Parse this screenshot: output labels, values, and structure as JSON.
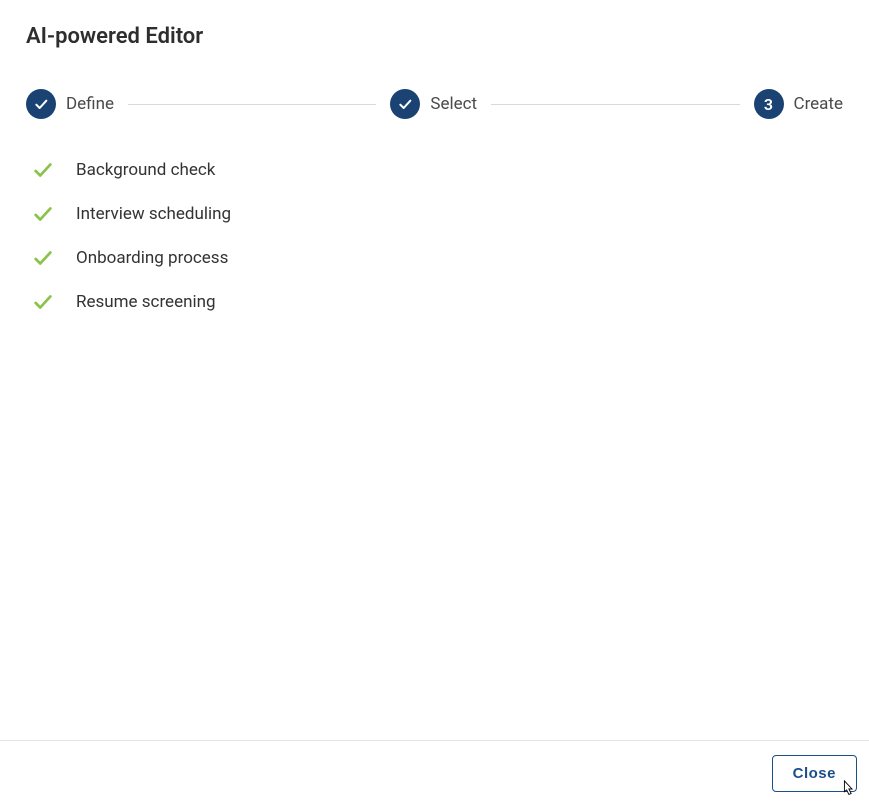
{
  "title": "AI-powered Editor",
  "stepper": {
    "steps": [
      {
        "label": "Define",
        "state": "done"
      },
      {
        "label": "Select",
        "state": "done"
      },
      {
        "label": "Create",
        "state": "current",
        "number": "3"
      }
    ]
  },
  "items": [
    {
      "label": "Background check"
    },
    {
      "label": "Interview scheduling"
    },
    {
      "label": "Onboarding process"
    },
    {
      "label": "Resume screening"
    }
  ],
  "footer": {
    "close_label": "Close"
  },
  "colors": {
    "step_circle": "#1a4373",
    "item_check": "#8bc34a",
    "button_border": "#1a4f8b"
  }
}
